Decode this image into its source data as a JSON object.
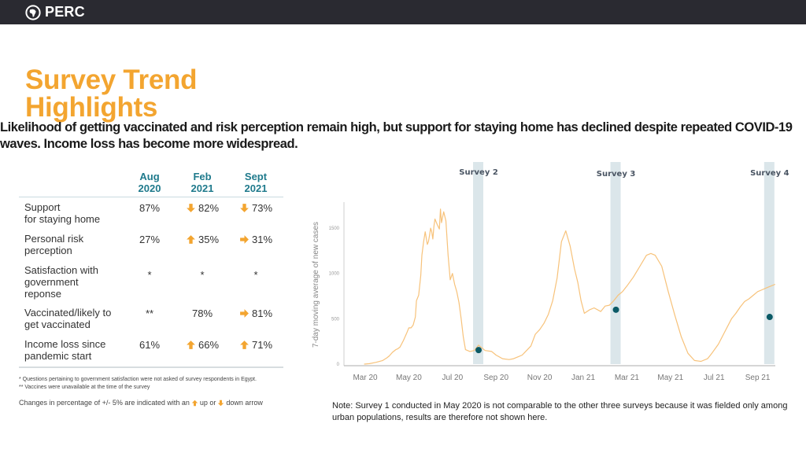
{
  "header": {
    "logo_icon": "africa-globe-icon",
    "brand": "PERC"
  },
  "page": {
    "title": "Survey Trend Highlights",
    "subtitle": "Likelihood of getting vaccinated and risk perception remain high, but support for staying home has declined despite repeated COVID-19 waves. Income loss has become more widespread."
  },
  "table": {
    "columns": [
      "Aug\n2020",
      "Feb\n2021",
      "Sept\n2021"
    ],
    "column_lines": [
      [
        "Aug",
        "2020"
      ],
      [
        "Feb",
        "2021"
      ],
      [
        "Sept",
        "2021"
      ]
    ],
    "rows": [
      {
        "label_lines": [
          "Support",
          "for staying home"
        ],
        "values": [
          {
            "text": "87%",
            "arrow": null
          },
          {
            "text": "82%",
            "arrow": "down"
          },
          {
            "text": "73%",
            "arrow": "down"
          }
        ]
      },
      {
        "label_lines": [
          "Personal risk",
          "perception"
        ],
        "values": [
          {
            "text": "27%",
            "arrow": null
          },
          {
            "text": "35%",
            "arrow": "up"
          },
          {
            "text": "31%",
            "arrow": "right"
          }
        ]
      },
      {
        "label_lines": [
          "Satisfaction with",
          "government",
          "reponse"
        ],
        "values": [
          {
            "text": "*",
            "arrow": null
          },
          {
            "text": "*",
            "arrow": null
          },
          {
            "text": "*",
            "arrow": null
          }
        ]
      },
      {
        "label_lines": [
          "Vaccinated/likely to",
          "get vaccinated"
        ],
        "values": [
          {
            "text": "**",
            "arrow": null
          },
          {
            "text": "78%",
            "arrow": null
          },
          {
            "text": "81%",
            "arrow": "right"
          }
        ]
      },
      {
        "label_lines": [
          "Income loss since",
          "pandemic start"
        ],
        "values": [
          {
            "text": "61%",
            "arrow": null
          },
          {
            "text": "66%",
            "arrow": "up"
          },
          {
            "text": "71%",
            "arrow": "up"
          }
        ]
      }
    ],
    "notes": [
      "* Questions pertaining to government satisfaction were not asked of survey respondents in Egypt.",
      "** Vaccines were unavailable at the time of the survey"
    ],
    "legend": {
      "before": "Changes in percentage of +/- 5% are indicated with an",
      "up": "up or",
      "down": "down arrow"
    },
    "arrow_color": "#F3A530",
    "header_color": "#1f7a8c"
  },
  "chart_data": {
    "type": "line",
    "title": "",
    "xlabel": "",
    "ylabel": "7-day moving average of new cases",
    "ylim": [
      0,
      1700
    ],
    "yticks": [
      0,
      500,
      1000,
      1500
    ],
    "xticks": [
      "Mar 20",
      "May 20",
      "Jul 20",
      "Sep 20",
      "Nov 20",
      "Jan 21",
      "Mar 21",
      "May 21",
      "Jul 21",
      "Sep 21"
    ],
    "x_units": "months since Mar 2020",
    "line_color": "#F7C27A",
    "series": [
      {
        "name": "7-day moving average of new cases",
        "x": [
          -0.05,
          0.2,
          0.5,
          0.8,
          1.0,
          1.1,
          1.25,
          1.4,
          1.5,
          1.6,
          1.75,
          1.9,
          2.0,
          2.1,
          2.2,
          2.3,
          2.35,
          2.45,
          2.55,
          2.6,
          2.68,
          2.75,
          2.85,
          2.9,
          2.95,
          3.0,
          3.05,
          3.1,
          3.15,
          3.2,
          3.3,
          3.4,
          3.45,
          3.5,
          3.6,
          3.7,
          3.8,
          3.9,
          4.0,
          4.1,
          4.2,
          4.3,
          4.4,
          4.5,
          4.6,
          4.8,
          5.0,
          5.2,
          5.5,
          5.8,
          6.0,
          6.3,
          6.6,
          6.8,
          7.0,
          7.2,
          7.4,
          7.6,
          7.8,
          8.0,
          8.2,
          8.4,
          8.6,
          8.8,
          9.0,
          9.2,
          9.4,
          9.6,
          9.75,
          9.9,
          10.05,
          10.3,
          10.5,
          10.8,
          11.0,
          11.2,
          11.4,
          11.6,
          11.8,
          12.0,
          12.3,
          12.6,
          12.9,
          13.1,
          13.3,
          13.6,
          13.9,
          14.2,
          14.5,
          14.8,
          15.1,
          15.4,
          15.7,
          15.9,
          16.2,
          16.5,
          16.8,
          17.0,
          17.2,
          17.4,
          17.6,
          17.8,
          18.0,
          18.2,
          18.4,
          18.6,
          18.8
        ],
        "values": [
          0,
          5,
          20,
          40,
          70,
          90,
          130,
          160,
          170,
          190,
          260,
          340,
          400,
          400,
          430,
          520,
          700,
          760,
          980,
          1200,
          1350,
          1460,
          1320,
          1350,
          1420,
          1500,
          1460,
          1380,
          1520,
          1600,
          1540,
          1490,
          1710,
          1560,
          1680,
          1580,
          1200,
          930,
          1000,
          880,
          800,
          680,
          500,
          300,
          160,
          140,
          150,
          210,
          150,
          140,
          100,
          60,
          50,
          60,
          80,
          100,
          150,
          200,
          330,
          380,
          450,
          550,
          700,
          950,
          1350,
          1470,
          1300,
          1050,
          900,
          700,
          560,
          600,
          620,
          580,
          640,
          650,
          700,
          760,
          800,
          860,
          960,
          1080,
          1200,
          1220,
          1200,
          1080,
          800,
          540,
          300,
          120,
          40,
          30,
          60,
          120,
          220,
          360,
          500,
          560,
          630,
          690,
          720,
          760,
          800,
          820,
          840,
          860,
          880
        ]
      }
    ],
    "surveys": [
      {
        "label": "Survey 2",
        "x": 5.2,
        "value": 155
      },
      {
        "label": "Survey 3",
        "x": 11.5,
        "value": 600
      },
      {
        "label": "Survey 4",
        "x": 18.55,
        "value": 520
      }
    ],
    "survey_band_color": "#dbe6ea",
    "marker_color": "#0b5a66",
    "grid": false
  },
  "footnote": "Note: Survey 1 conducted in May 2020 is not comparable to the other three surveys because it was fielded only among urban populations,  results are therefore not shown here."
}
